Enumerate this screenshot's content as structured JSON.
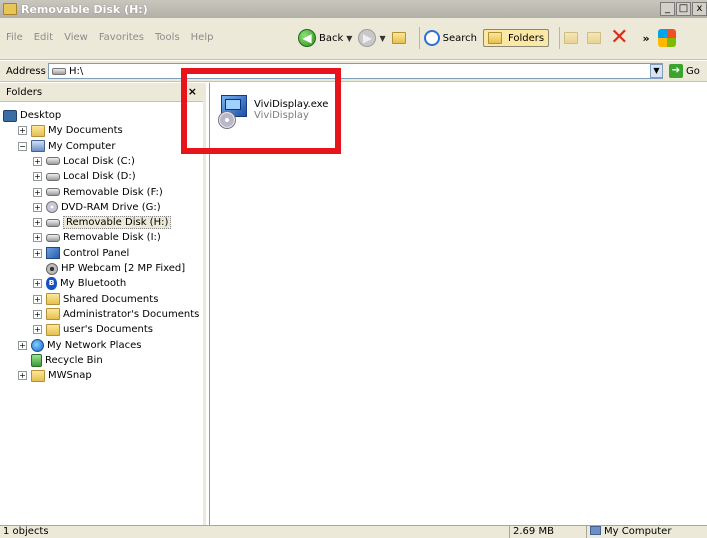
{
  "window": {
    "title": "Removable Disk (H:)",
    "buttons": [
      "_",
      "□",
      "x"
    ]
  },
  "menu": [
    "File",
    "Edit",
    "View",
    "Favorites",
    "Tools",
    "Help"
  ],
  "toolbar": {
    "back_label": "Back",
    "search_label": "Search",
    "folders_label": "Folders",
    "chevron": "»"
  },
  "address": {
    "label": "Address",
    "value": "H:\\",
    "go_label": "Go"
  },
  "folder_pane": {
    "title": "Folders",
    "close": "×",
    "items": [
      {
        "label": "Desktop",
        "icon": "desktop-icon",
        "expander": ""
      },
      {
        "label": "My Documents",
        "icon": "folder-icon",
        "expander": "+"
      },
      {
        "label": "My Computer",
        "icon": "computer-icon",
        "expander": "−"
      },
      {
        "label": "Local Disk (C:)",
        "icon": "drive-icon",
        "expander": "+"
      },
      {
        "label": "Local Disk (D:)",
        "icon": "drive-icon",
        "expander": "+"
      },
      {
        "label": "Removable Disk (F:)",
        "icon": "drive-icon",
        "expander": "+"
      },
      {
        "label": "DVD-RAM Drive (G:)",
        "icon": "dvd-icon",
        "expander": "+"
      },
      {
        "label": "Removable Disk (H:)",
        "icon": "drive-icon",
        "expander": "+",
        "selected": true
      },
      {
        "label": "Removable Disk (I:)",
        "icon": "drive-icon",
        "expander": "+"
      },
      {
        "label": "Control Panel",
        "icon": "control-panel-icon",
        "expander": "+"
      },
      {
        "label": "HP Webcam [2 MP Fixed]",
        "icon": "webcam-icon",
        "expander": ""
      },
      {
        "label": "My Bluetooth",
        "icon": "bluetooth-icon",
        "expander": "+"
      },
      {
        "label": "Shared Documents",
        "icon": "folder-icon",
        "expander": "+"
      },
      {
        "label": "Administrator's Documents",
        "icon": "folder-icon",
        "expander": "+"
      },
      {
        "label": "user's Documents",
        "icon": "folder-icon",
        "expander": "+"
      },
      {
        "label": "My Network Places",
        "icon": "network-icon",
        "expander": "+"
      },
      {
        "label": "Recycle Bin",
        "icon": "recycle-bin-icon",
        "expander": ""
      },
      {
        "label": "MWSnap",
        "icon": "folder-icon",
        "expander": "+"
      }
    ]
  },
  "files": [
    {
      "name": "ViviDisplay.exe",
      "description": "ViviDisplay",
      "icon": "installer-exe-icon"
    }
  ],
  "status": {
    "objects": "1 objects",
    "size": "2.69 MB",
    "location": "My Computer"
  },
  "colors": {
    "highlight_box": "#e8141c",
    "titlebar": "#b3b0a8",
    "chrome": "#ece9d8"
  }
}
